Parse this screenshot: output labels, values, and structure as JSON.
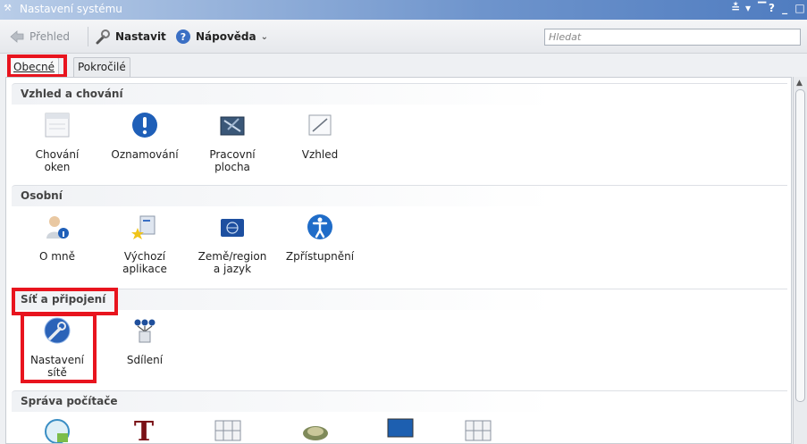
{
  "window": {
    "title": "Nastavení systému",
    "controls": "? _ □"
  },
  "toolbar": {
    "overview_label": "Přehled",
    "configure_label": "Nastavit",
    "help_label": "Nápověda",
    "search_placeholder": "Hledat"
  },
  "tabs": [
    {
      "label": "Obecné",
      "active": true
    },
    {
      "label": "Pokročilé",
      "active": false
    }
  ],
  "sections": [
    {
      "title": "Vzhled a chování",
      "items": [
        {
          "label_line1": "Chování",
          "label_line2": "oken",
          "icon": "window-behavior-icon"
        },
        {
          "label_line1": "Oznamování",
          "label_line2": "",
          "icon": "notification-icon"
        },
        {
          "label_line1": "Pracovní",
          "label_line2": "plocha",
          "icon": "desktop-icon"
        },
        {
          "label_line1": "Vzhled",
          "label_line2": "",
          "icon": "appearance-icon"
        }
      ]
    },
    {
      "title": "Osobní",
      "items": [
        {
          "label_line1": "O mně",
          "label_line2": "",
          "icon": "about-me-icon"
        },
        {
          "label_line1": "Výchozí",
          "label_line2": "aplikace",
          "icon": "default-apps-icon"
        },
        {
          "label_line1": "Země/region",
          "label_line2": "a jazyk",
          "icon": "locale-icon"
        },
        {
          "label_line1": "Zpřístupnění",
          "label_line2": "",
          "icon": "accessibility-icon"
        }
      ]
    },
    {
      "title": "Síť a připojení",
      "items": [
        {
          "label_line1": "Nastavení",
          "label_line2": "sítě",
          "icon": "network-settings-icon"
        },
        {
          "label_line1": "Sdílení",
          "label_line2": "",
          "icon": "sharing-icon"
        }
      ]
    },
    {
      "title": "Správa počítače",
      "items": []
    }
  ],
  "colors": {
    "highlight": "#e8141e",
    "titlebar": "#6e94cc"
  }
}
